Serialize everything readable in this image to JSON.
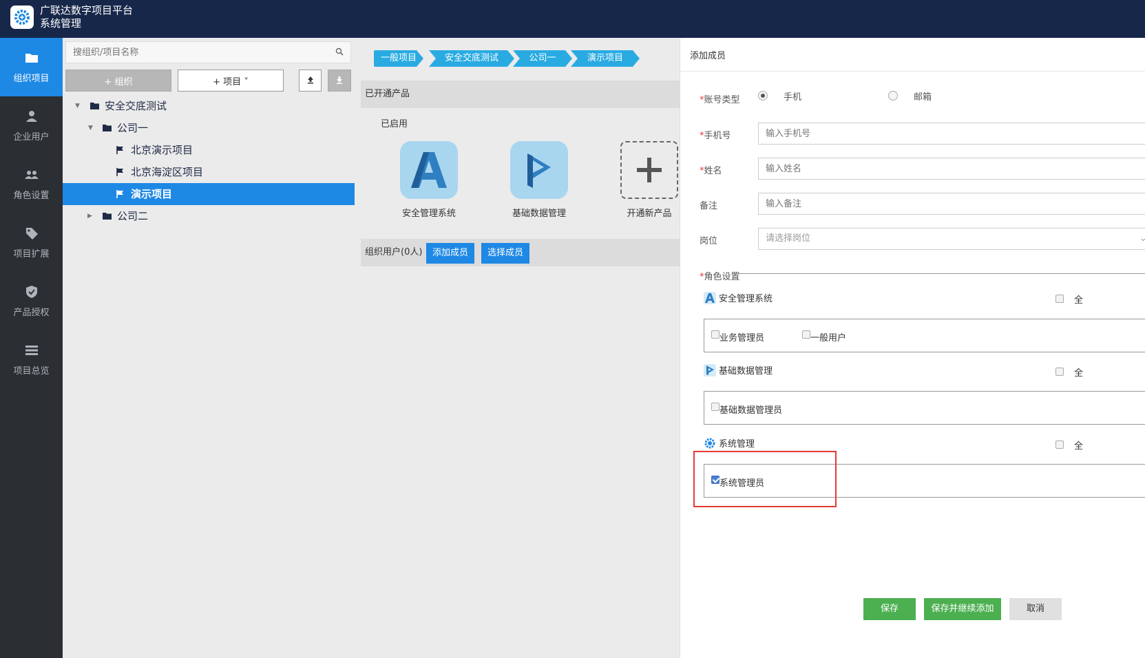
{
  "header": {
    "app_name": "广联达数字项目平台",
    "module_name": "系统管理",
    "logo_icon": "gear-globe-icon"
  },
  "leftnav": {
    "items": [
      {
        "label": "组织项目",
        "icon": "folder-icon",
        "active": true
      },
      {
        "label": "企业用户",
        "icon": "user-icon"
      },
      {
        "label": "角色设置",
        "icon": "users-icon"
      },
      {
        "label": "项目扩展",
        "icon": "tag-icon"
      },
      {
        "label": "产品授权",
        "icon": "shield-check-icon"
      },
      {
        "label": "项目总览",
        "icon": "list-icon"
      }
    ]
  },
  "tree": {
    "search_placeholder": "搜组织/项目名称",
    "add_org_label": "+ 组织",
    "add_project_label": "+ 项目 ˅",
    "nodes": [
      {
        "label": "安全交底测试",
        "type": "folder",
        "expanded": true
      },
      {
        "label": "公司一",
        "type": "folder",
        "expanded": true
      },
      {
        "label": "北京演示项目",
        "type": "project"
      },
      {
        "label": "北京海淀区项目",
        "type": "project"
      },
      {
        "label": "演示项目",
        "type": "project",
        "selected": true
      },
      {
        "label": "公司二",
        "type": "folder",
        "expanded": false
      }
    ]
  },
  "breadcrumb": [
    "一般项目",
    "安全交底测试",
    "公司一",
    "演示项目"
  ],
  "products": {
    "section_title": "已开通产品",
    "enabled_label": "已启用",
    "items": [
      {
        "label": "安全管理系统",
        "icon": "letter-a-icon"
      },
      {
        "label": "基础数据管理",
        "icon": "play-logo-icon"
      },
      {
        "label": "开通新产品",
        "icon": "plus-icon"
      }
    ]
  },
  "org_users": {
    "label": "组织用户(0人)",
    "add_member_label": "添加成员",
    "select_member_label": "选择成员"
  },
  "drawer": {
    "title": "添加成员",
    "account_type_label": "账号类型",
    "account_type_options": [
      "手机",
      "邮箱"
    ],
    "account_type_selected": "手机",
    "phone_label": "手机号",
    "phone_placeholder": "输入手机号",
    "name_label": "姓名",
    "name_placeholder": "输入姓名",
    "remark_label": "备注",
    "remark_placeholder": "输入备注",
    "post_label": "岗位",
    "post_placeholder": "请选择岗位",
    "role_settings_label": "角色设置",
    "all_label": "全",
    "systems": [
      {
        "name": "安全管理系统",
        "icon": "letter-a-icon",
        "roles": [
          {
            "label": "业务管理员",
            "checked": false
          },
          {
            "label": "一般用户",
            "checked": false
          }
        ]
      },
      {
        "name": "基础数据管理",
        "icon": "play-logo-icon",
        "roles": [
          {
            "label": "基础数据管理员",
            "checked": false
          }
        ]
      },
      {
        "name": "系统管理",
        "icon": "gear-globe-icon",
        "roles": [
          {
            "label": "系统管理员",
            "checked": true
          }
        ]
      }
    ],
    "save_label": "保存",
    "save_continue_label": "保存并继续添加",
    "cancel_label": "取消"
  },
  "colors": {
    "header_bg": "#17274a",
    "nav_bg": "#2b2f33",
    "accent_blue": "#1e88e5",
    "crumb_blue": "#29abe2",
    "save_green": "#4caf50",
    "highlight_red": "#e53935"
  }
}
